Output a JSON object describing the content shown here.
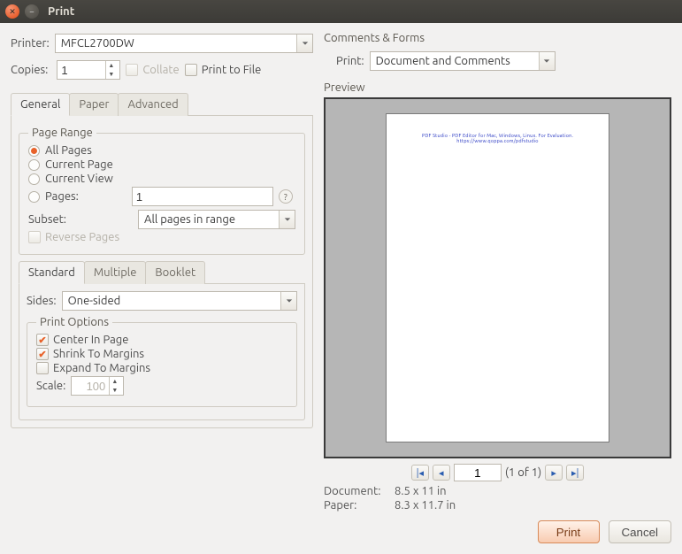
{
  "window": {
    "title": "Print"
  },
  "printer": {
    "label": "Printer:",
    "value": "MFCL2700DW"
  },
  "copies": {
    "label": "Copies:",
    "value": "1",
    "collate_label": "Collate",
    "print_to_file_label": "Print to File"
  },
  "tabs_main": {
    "general": "General",
    "paper": "Paper",
    "advanced": "Advanced"
  },
  "page_range": {
    "legend": "Page Range",
    "all": "All Pages",
    "current_page": "Current Page",
    "current_view": "Current View",
    "pages_label": "Pages:",
    "pages_value": "1",
    "subset_label": "Subset:",
    "subset_value": "All pages in range",
    "reverse_label": "Reverse Pages"
  },
  "layout_tabs": {
    "standard": "Standard",
    "multiple": "Multiple",
    "booklet": "Booklet"
  },
  "sides": {
    "label": "Sides:",
    "value": "One-sided"
  },
  "print_options": {
    "legend": "Print Options",
    "center": "Center In Page",
    "shrink": "Shrink To Margins",
    "expand": "Expand To Margins",
    "scale_label": "Scale:",
    "scale_value": "100"
  },
  "comments": {
    "title": "Comments & Forms",
    "print_label": "Print:",
    "value": "Document and Comments"
  },
  "preview": {
    "title": "Preview",
    "watermark": "PDF Studio - PDF Editor for Mac, Windows, Linux. For Evaluation. https://www.qoppa.com/pdfstudio",
    "page_field": "1",
    "page_of": "(1 of 1)",
    "doc_label": "Document:",
    "doc_value": "8.5 x 11 in",
    "paper_label": "Paper:",
    "paper_value": "8.3 x 11.7 in"
  },
  "buttons": {
    "print": "Print",
    "cancel": "Cancel"
  }
}
